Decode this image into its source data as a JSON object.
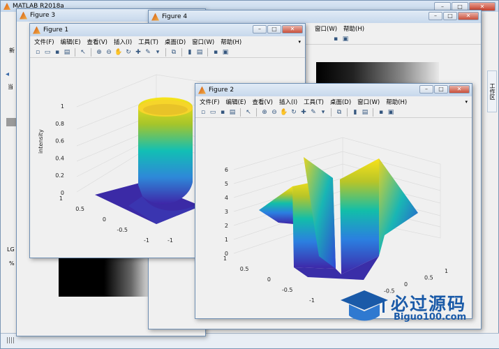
{
  "main": {
    "title": "MATLAB R2018a",
    "left_bits": [
      "文",
      "新",
      "当",
      "LG",
      "%"
    ],
    "side_tab": "工作区",
    "status_glyph": "||||"
  },
  "windows": {
    "fig3": {
      "title": "Figure 3"
    },
    "fig4": {
      "title": "Figure 4",
      "menu": [
        "窗口(W)",
        "帮助(H)"
      ]
    },
    "fig1": {
      "title": "Figure 1",
      "menu": [
        "文件(F)",
        "编辑(E)",
        "查看(V)",
        "插入(I)",
        "工具(T)",
        "桌面(D)",
        "窗口(W)",
        "帮助(H)"
      ],
      "axes": {
        "zlabel": "intensity",
        "zticks": [
          "1",
          "0.8",
          "0.6",
          "0.4",
          "0.2",
          "0"
        ],
        "yticks": [
          "1",
          "0.5",
          "0",
          "-0.5",
          "-1"
        ],
        "xticks": [
          "-1"
        ]
      }
    },
    "fig2": {
      "title": "Figure 2",
      "menu": [
        "文件(F)",
        "编辑(E)",
        "查看(V)",
        "插入(I)",
        "工具(T)",
        "桌面(D)",
        "窗口(W)",
        "帮助(H)"
      ],
      "axes": {
        "zticks": [
          "6",
          "5",
          "4",
          "3",
          "2",
          "1",
          "0"
        ],
        "yticks": [
          "1",
          "0.5",
          "0",
          "-0.5",
          "-1"
        ],
        "xticks": [
          "-1",
          "-0.5",
          "0",
          "0.5",
          "1"
        ]
      }
    }
  },
  "watermark": {
    "text": "必过源码",
    "url": "Biguo100.com"
  },
  "colors": {
    "title_bar": "#c7d8ec",
    "surface_low": "#3b2ba8",
    "surface_high": "#f9e21c"
  }
}
